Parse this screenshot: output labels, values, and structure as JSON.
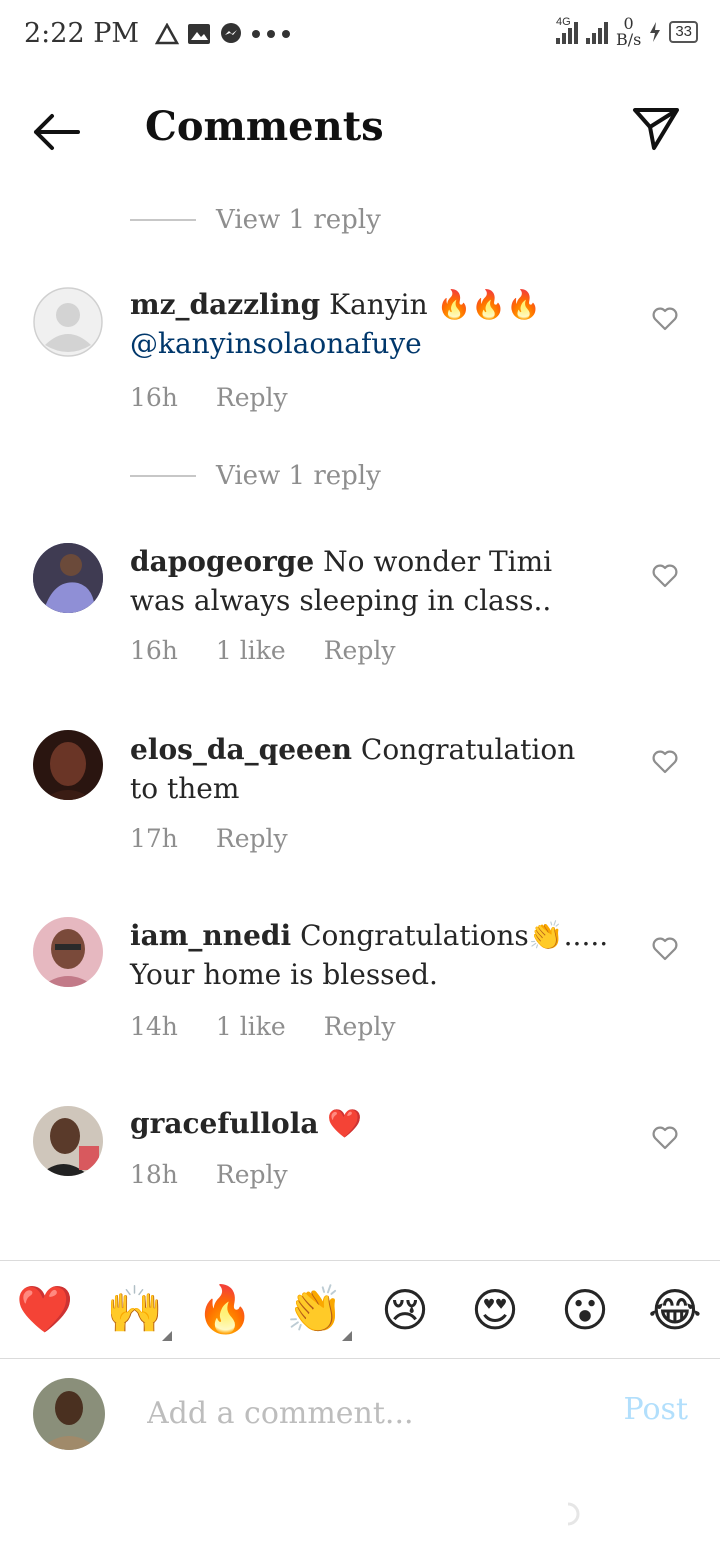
{
  "status_bar": {
    "time": "2:22 PM",
    "network": "4G",
    "speed_value": "0",
    "speed_unit": "B/s",
    "battery": "33",
    "icons": [
      "alert-icon",
      "image-icon",
      "messenger-icon",
      "more-dots-icon",
      "signal-icon",
      "charging-icon",
      "battery-icon"
    ]
  },
  "header": {
    "title": "Comments",
    "back_icon": "arrow-left-icon",
    "share_icon": "send-icon"
  },
  "view_reply_label": "View 1 reply",
  "comments": [
    {
      "username": "mz_dazzling",
      "text": "Kanyin 🔥🔥🔥",
      "mention": "@kanyinsolaonafuye",
      "time": "16h",
      "likes": "",
      "reply": "Reply",
      "avatar_color": "#d9d9d9"
    },
    {
      "username": "dapogeorge",
      "text": "No wonder Timi was always sleeping in class..",
      "mention": "",
      "time": "16h",
      "likes": "1 like",
      "reply": "Reply",
      "avatar_color": "#5b5fa8"
    },
    {
      "username": "elos_da_qeeen",
      "text": "Congratulation to them",
      "mention": "",
      "time": "17h",
      "likes": "",
      "reply": "Reply",
      "avatar_color": "#4a2418"
    },
    {
      "username": "iam_nnedi",
      "text": "Congratulations👏..... Your home is blessed.",
      "mention": "",
      "time": "14h",
      "likes": "1 like",
      "reply": "Reply",
      "avatar_color": "#c98c8c"
    },
    {
      "username": "gracefullola",
      "text": "❤️",
      "mention": "",
      "time": "18h",
      "likes": "",
      "reply": "Reply",
      "avatar_color": "#8a7a6a"
    }
  ],
  "emoji_bar": [
    "❤️",
    "🙌",
    "🔥",
    "👏",
    "😢",
    "😍",
    "😮",
    "😂"
  ],
  "compose": {
    "placeholder": "Add a comment...",
    "post_label": "Post"
  },
  "colors": {
    "mention": "#00376b",
    "muted": "#8e8e8e",
    "post_disabled": "#b2dffc"
  }
}
